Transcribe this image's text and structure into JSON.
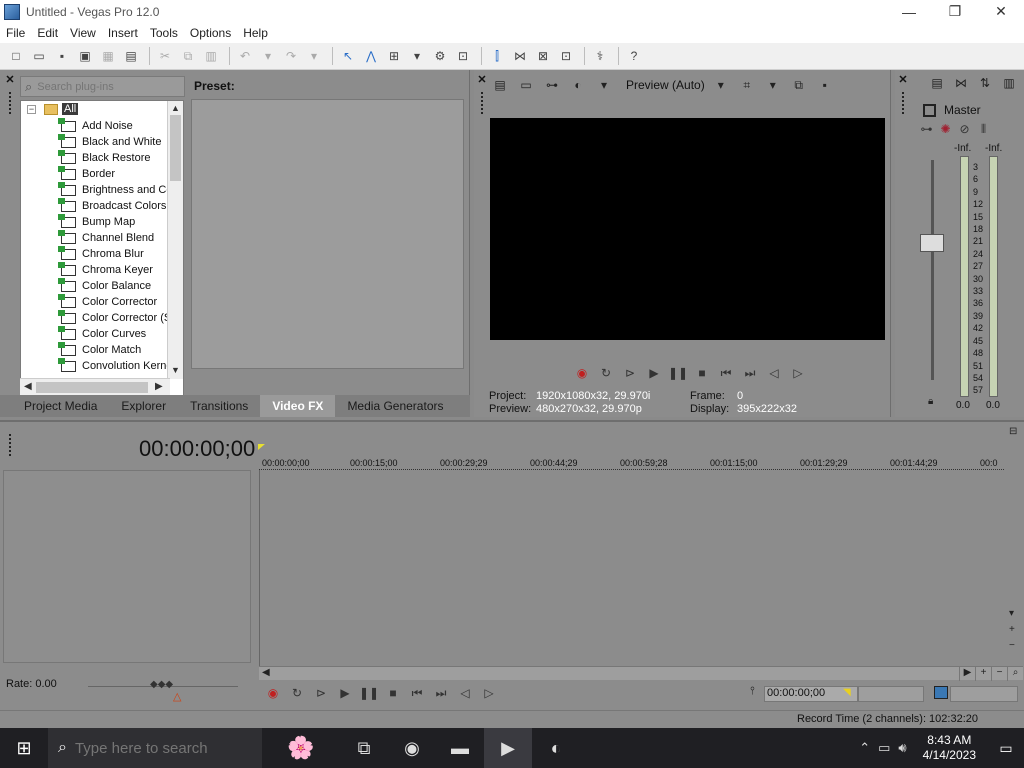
{
  "window": {
    "title": "Untitled - Vegas Pro 12.0",
    "minimize": "—",
    "restore": "❐",
    "close": "✕"
  },
  "menu": [
    "File",
    "Edit",
    "View",
    "Insert",
    "Tools",
    "Options",
    "Help"
  ],
  "toolbar_icons": [
    "new-project-icon",
    "open-icon",
    "save-icon",
    "save-as-icon",
    "render-icon",
    "properties-icon",
    "cut-icon",
    "copy-icon",
    "paste-icon",
    "undo-icon",
    "redo-icon",
    "normal-edit-tool-icon",
    "envelope-edit-tool-icon",
    "selection-edit-tool-icon",
    "enable-snapping-icon",
    "auto-ripple-icon",
    "lock-envelopes-icon",
    "ignore-event-grouping-icon",
    "auto-crossfade-icon",
    "zoom-tool-icon",
    "plugins-icon",
    "whats-this-help-icon"
  ],
  "plugins": {
    "search_placeholder": "Search plug-ins",
    "preset_label": "Preset:",
    "root": "All",
    "items": [
      "Add Noise",
      "Black and White",
      "Black Restore",
      "Border",
      "Brightness and Co",
      "Broadcast Colors",
      "Bump Map",
      "Channel Blend",
      "Chroma Blur",
      "Chroma Keyer",
      "Color Balance",
      "Color Corrector",
      "Color Corrector (S",
      "Color Curves",
      "Color Match",
      "Convolution Kerne"
    ],
    "tabs": [
      "Project Media",
      "Explorer",
      "Transitions",
      "Video FX",
      "Media Generators"
    ],
    "active_tab": "Video FX"
  },
  "preview": {
    "quality": "Preview (Auto)",
    "project_label": "Project:",
    "project_value": "1920x1080x32, 29.970i",
    "preview_label": "Preview:",
    "preview_value": "480x270x32, 29.970p",
    "frame_label": "Frame:",
    "frame_value": "0",
    "display_label": "Display:",
    "display_value": "395x222x32"
  },
  "mixer": {
    "master_label": "Master",
    "inf_left": "-Inf.",
    "inf_right": "-Inf.",
    "scale": [
      "3",
      "6",
      "9",
      "12",
      "15",
      "18",
      "21",
      "24",
      "27",
      "30",
      "33",
      "36",
      "39",
      "42",
      "45",
      "48",
      "51",
      "54",
      "57"
    ],
    "value_left": "0.0",
    "value_right": "0.0"
  },
  "timeline": {
    "time": "00:00:00;00",
    "ruler": [
      "00:00:00;00",
      "00:00:15;00",
      "00:00:29;29",
      "00:00:44;29",
      "00:00:59;28",
      "00:01:15;00",
      "00:01:29;29",
      "00:01:44;29",
      "00:0"
    ],
    "rate": "Rate: 0.00",
    "cursor_time": "00:00:00;00",
    "record_time": "Record Time (2 channels): 102:32:20"
  },
  "taskbar": {
    "search_placeholder": "Type here to search",
    "time": "8:43 AM",
    "date": "4/14/2023"
  }
}
